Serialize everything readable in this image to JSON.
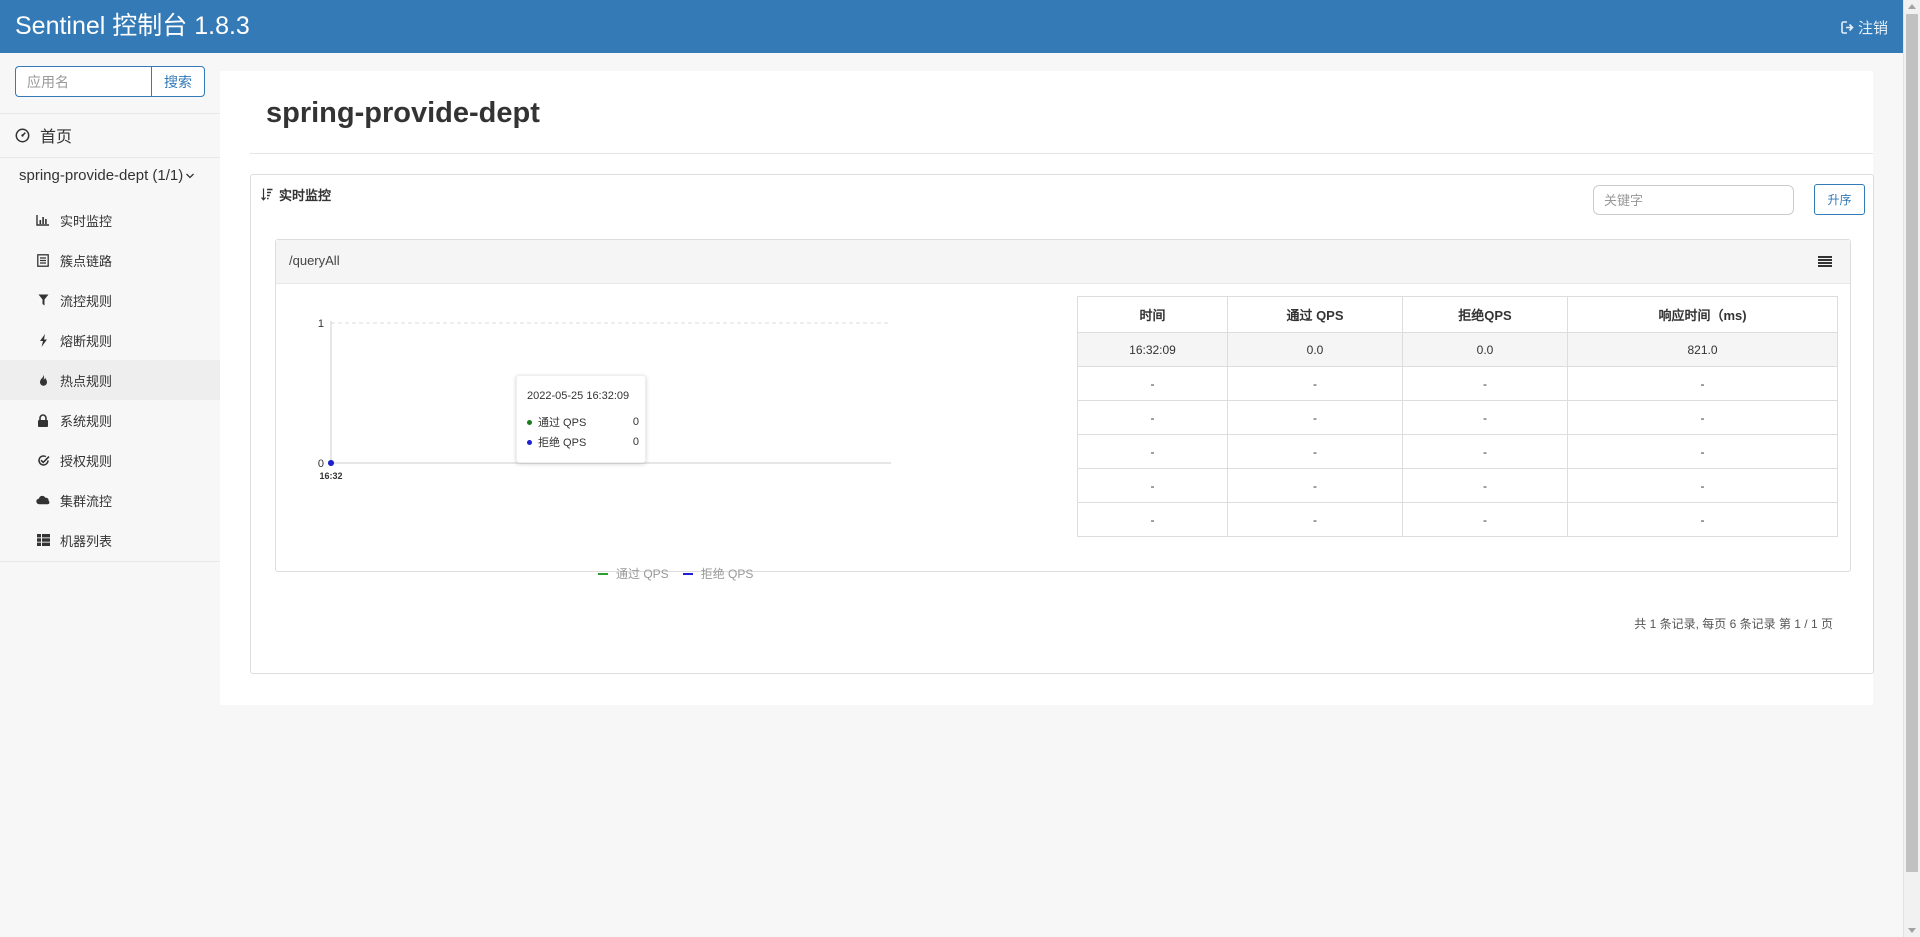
{
  "header": {
    "brand": "Sentinel 控制台 1.8.3",
    "logout_label": "注销"
  },
  "sidebar": {
    "search": {
      "placeholder": "应用名",
      "value": "",
      "button": "搜索"
    },
    "home_label": "首页",
    "app_label": "spring-provide-dept (1/1)",
    "items": [
      {
        "label": "实时监控",
        "icon": "bar-chart-icon"
      },
      {
        "label": "簇点链路",
        "icon": "list-icon"
      },
      {
        "label": "流控规则",
        "icon": "filter-icon"
      },
      {
        "label": "熔断规则",
        "icon": "flash-icon"
      },
      {
        "label": "热点规则",
        "icon": "fire-icon"
      },
      {
        "label": "系统规则",
        "icon": "lock-icon"
      },
      {
        "label": "授权规则",
        "icon": "check-icon"
      },
      {
        "label": "集群流控",
        "icon": "cloud-icon"
      },
      {
        "label": "机器列表",
        "icon": "th-list-icon"
      }
    ]
  },
  "main": {
    "title": "spring-provide-dept",
    "panel_title": "实时监控",
    "keyword_placeholder": "关键字",
    "sort_button": "升序",
    "card": {
      "resource": "/queryAll",
      "chart_data": {
        "type": "line",
        "x": [
          "16:32"
        ],
        "series": [
          {
            "name": "通过 QPS",
            "color": "#2ca02c",
            "values": [
              0
            ]
          },
          {
            "name": "拒绝 QPS",
            "color": "#1f1fd6",
            "values": [
              0
            ]
          }
        ],
        "ylim": [
          0,
          1
        ],
        "yticks": [
          "1",
          "0"
        ],
        "xticks": [
          "16:32"
        ],
        "legend": "bottom",
        "tooltip": {
          "time": "2022-05-25 16:32:09",
          "rows": [
            {
              "name": "通过 QPS",
              "value": "0",
              "color": "#1e7b1e"
            },
            {
              "name": "拒绝 QPS",
              "value": "0",
              "color": "#1f1fd6"
            }
          ]
        }
      },
      "table": {
        "headers": [
          "时间",
          "通过 QPS",
          "拒绝QPS",
          "响应时间（ms)"
        ],
        "rows": [
          [
            "16:32:09",
            "0.0",
            "0.0",
            "821.0"
          ],
          [
            "-",
            "-",
            "-",
            "-"
          ],
          [
            "-",
            "-",
            "-",
            "-"
          ],
          [
            "-",
            "-",
            "-",
            "-"
          ],
          [
            "-",
            "-",
            "-",
            "-"
          ],
          [
            "-",
            "-",
            "-",
            "-"
          ]
        ]
      }
    },
    "pagination": "共 1 条记录, 每页 6 条记录 第 1 / 1 页"
  }
}
